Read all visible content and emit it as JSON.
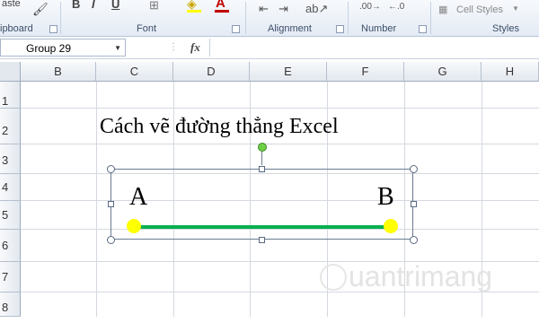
{
  "ribbon": {
    "clipboard_top": "aste",
    "clipboard_label": "ipboard",
    "font_label": "Font",
    "alignment_label": "Alignment",
    "number_label": "Number",
    "cell_styles": "Cell Styles",
    "styles_label": "Styles",
    "bold": "B",
    "italic": "I",
    "font_color": "A"
  },
  "formula_bar": {
    "name_box": "Group 29",
    "fx": "fx",
    "formula": ""
  },
  "columns": [
    "B",
    "C",
    "D",
    "E",
    "F",
    "G",
    "H"
  ],
  "rows": [
    "1",
    "2",
    "3",
    "4",
    "5",
    "6",
    "7",
    "8"
  ],
  "sheet": {
    "title": "Cách vẽ đường thẳng Excel",
    "point_a": "A",
    "point_b": "B"
  },
  "watermark": "uantrimang",
  "colors": {
    "line": "#00b050",
    "endpoints": "#ffff00",
    "rotation_handle": "#6fd048"
  }
}
